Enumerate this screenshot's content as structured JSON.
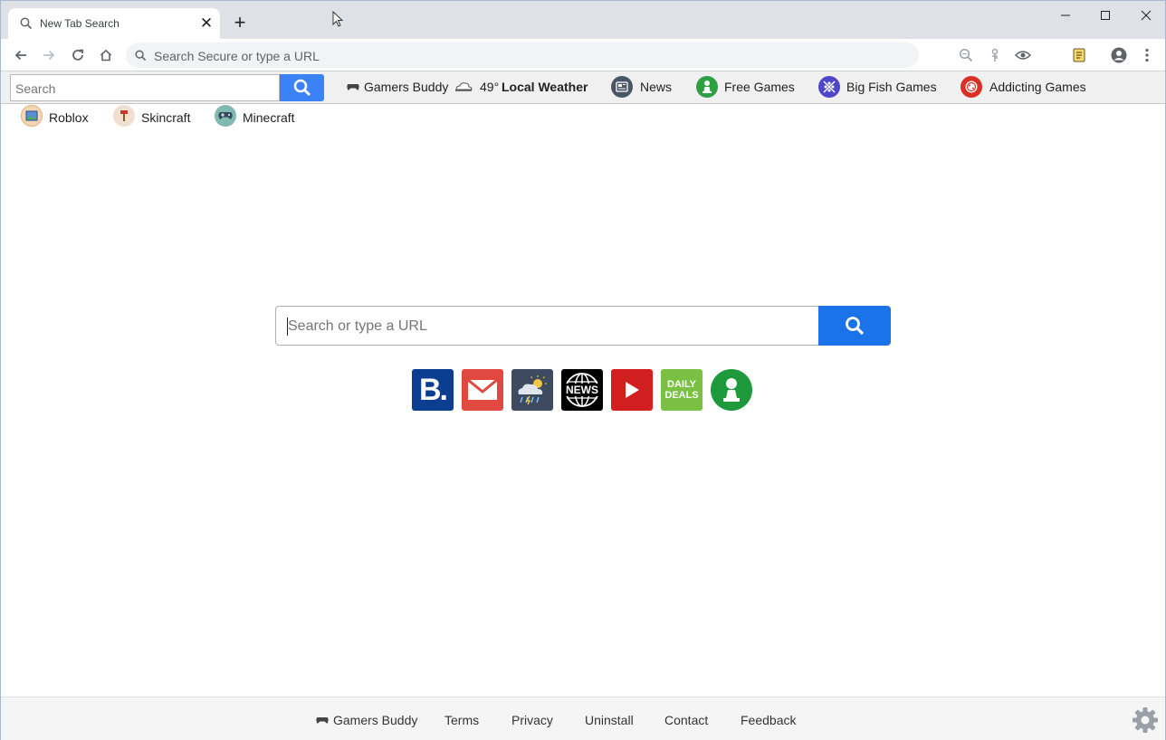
{
  "tab": {
    "title": "New Tab Search",
    "close": "✕",
    "new_tab": "+"
  },
  "window_controls": {
    "minimize": "minimize-icon",
    "maximize": "maximize-icon",
    "close": "close-icon"
  },
  "omnibox": {
    "placeholder": "Search Secure or type a URL"
  },
  "bookmark_bar": {
    "search_placeholder": "Search",
    "links": [
      {
        "label": "Gamers Buddy",
        "icon": "gamepad-icon"
      },
      {
        "temp": "49°",
        "label": "Local Weather",
        "icon": "weather-cloud-icon"
      },
      {
        "label": "News",
        "icon": "newspaper-icon",
        "color": "#4a5568"
      },
      {
        "label": "Free Games",
        "icon": "pawn-icon",
        "color": "#2ea043"
      },
      {
        "label": "Big Fish Games",
        "icon": "puzzle-icon",
        "color": "#4f46c8"
      },
      {
        "label": "Addicting Games",
        "icon": "dice-icon",
        "color": "#d93025"
      }
    ],
    "row2": [
      {
        "label": "Roblox",
        "icon": "image-icon",
        "color": "#f3d7b5"
      },
      {
        "label": "Skincraft",
        "icon": "paint-roller-icon",
        "color": "#f0e0d0"
      },
      {
        "label": "Minecraft",
        "icon": "controller-icon",
        "color": "#7fb9b0"
      }
    ]
  },
  "main": {
    "search_placeholder": "Search or type a URL",
    "tiles": [
      {
        "name": "booking-tile",
        "label": "B.",
        "color": "#0b3d91"
      },
      {
        "name": "gmail-tile",
        "label": "",
        "color": "#e1483f"
      },
      {
        "name": "weather-tile",
        "label": "",
        "color": "#3d4a60"
      },
      {
        "name": "news-tile",
        "label": "NEWS",
        "color": "#000000"
      },
      {
        "name": "youtube-tile",
        "label": "",
        "color": "#d11f1f"
      },
      {
        "name": "daily-deals-tile",
        "label": "DAILY DEALS",
        "color": "#7ac143"
      },
      {
        "name": "games-tile",
        "label": "",
        "color": "#1e9a3c"
      }
    ]
  },
  "footer": {
    "links": [
      "Gamers Buddy",
      "Terms",
      "Privacy",
      "Uninstall",
      "Contact",
      "Feedback"
    ]
  }
}
